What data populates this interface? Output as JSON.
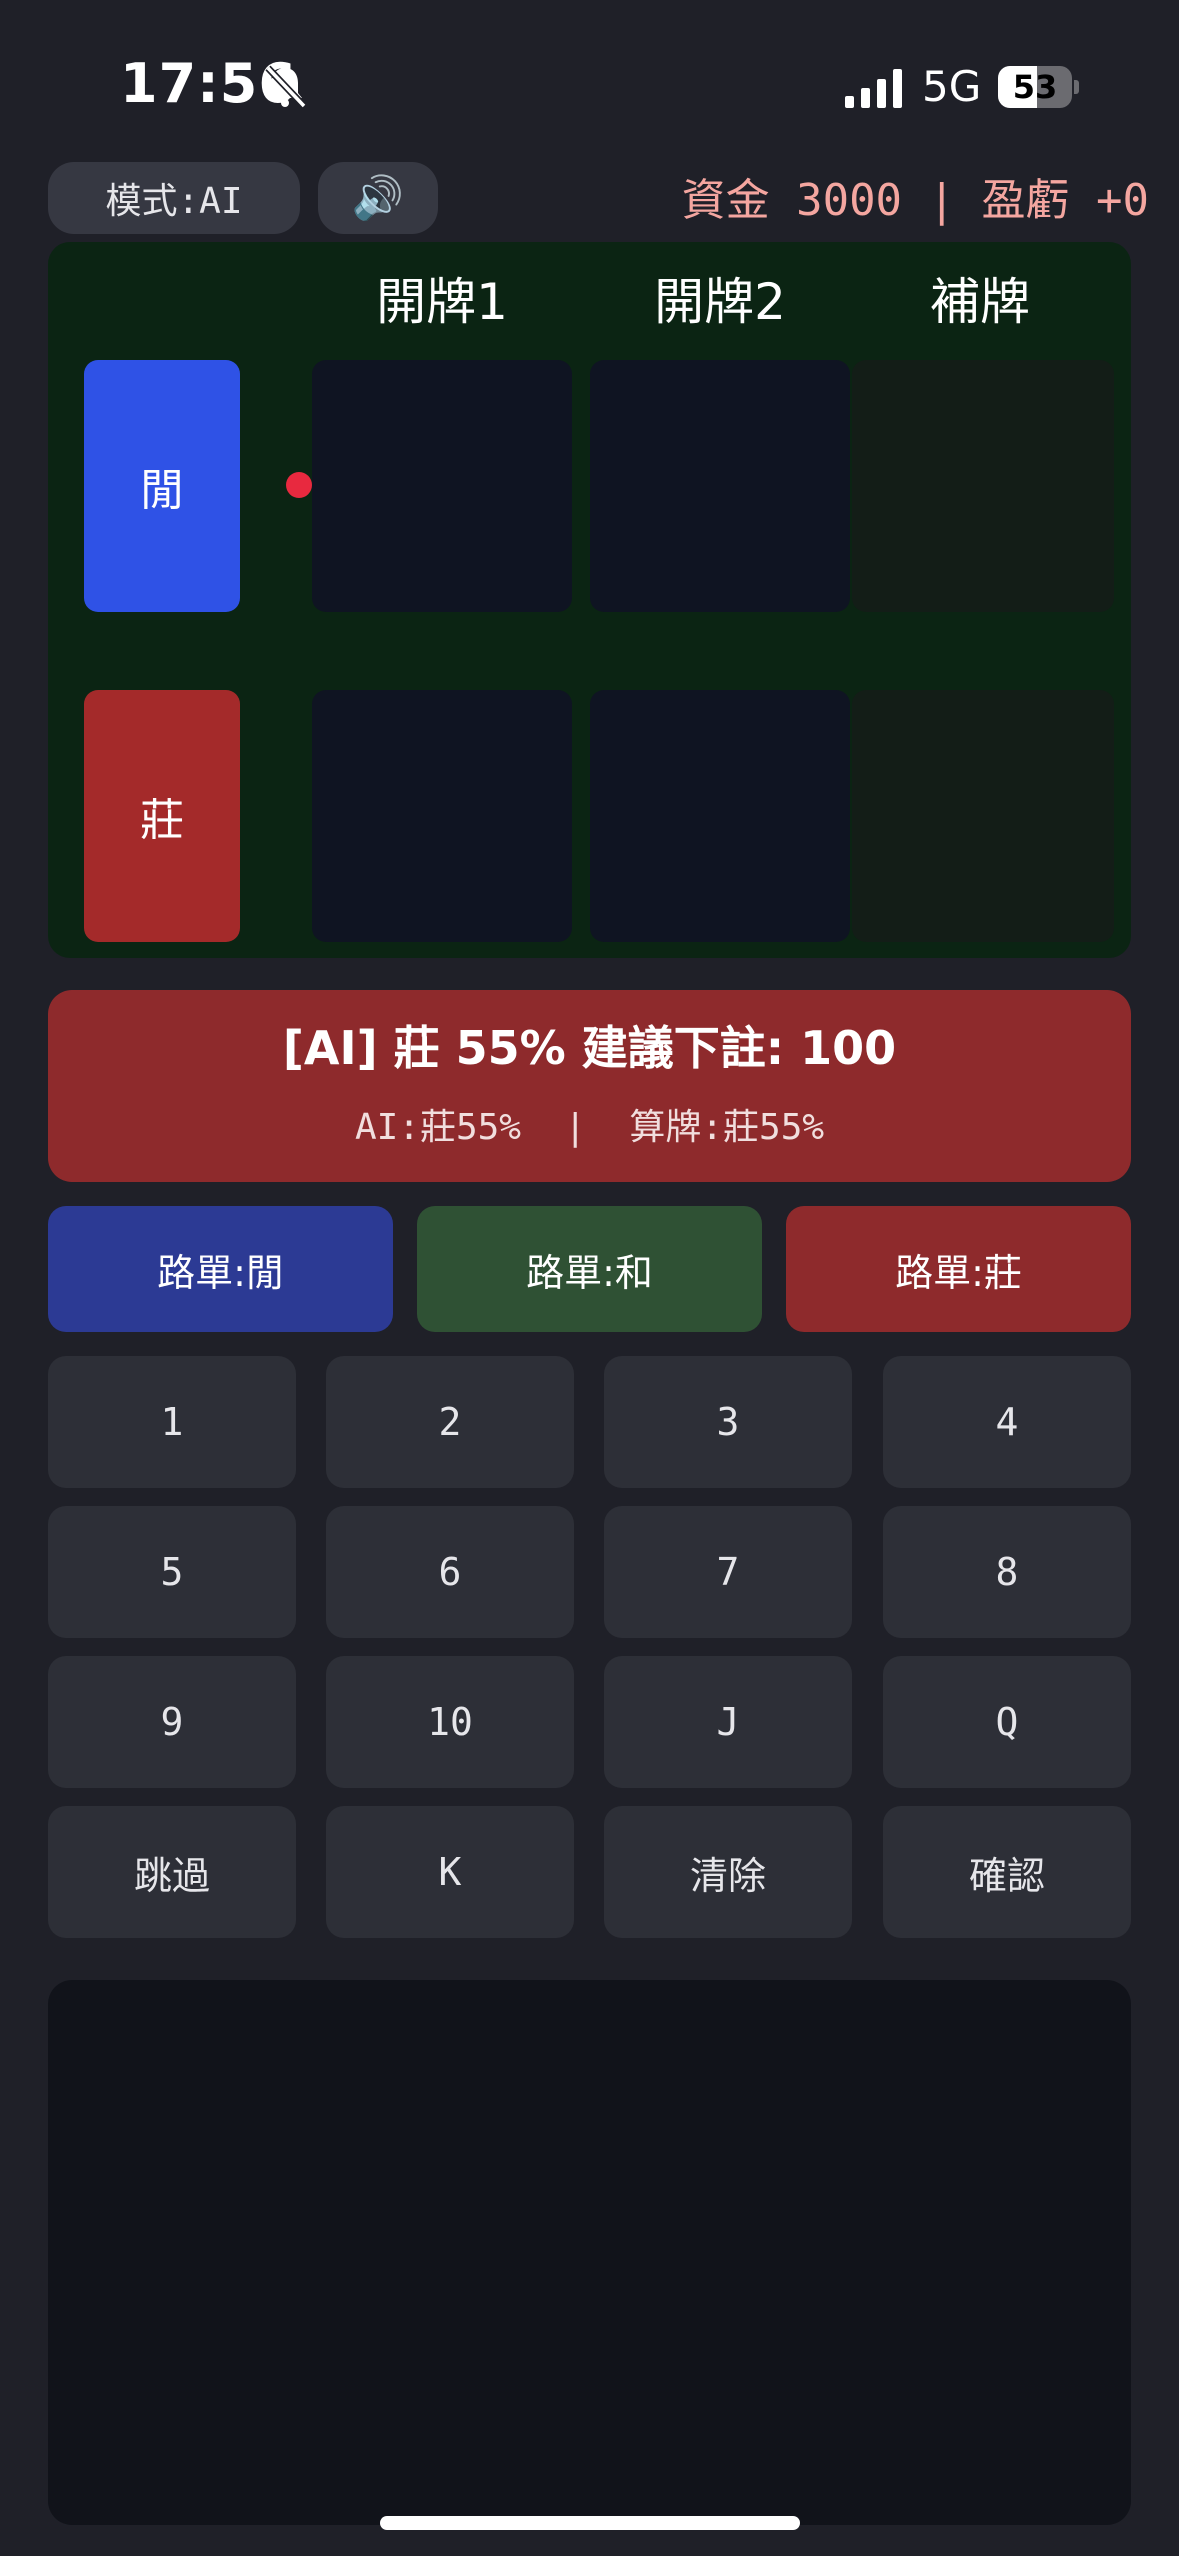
{
  "status_bar": {
    "time": "17:56",
    "network": "5G",
    "battery": "53",
    "battery_level": 0.53
  },
  "toolbar": {
    "mode_label": "模式:AI",
    "sound_icon": "speaker-icon",
    "funds_text": "資金 3000 | 盈虧 +0"
  },
  "table": {
    "columns": [
      "開牌1",
      "開牌2",
      "補牌"
    ],
    "player_label": "閒",
    "banker_label": "莊",
    "colors": {
      "player": "#2f52e6",
      "banker": "#a42a2a",
      "felt": "#0b2413",
      "indicator": "#e8293f"
    }
  },
  "advice": {
    "main": "[AI] 莊 55%  建議下註: 100",
    "sub": "AI:莊55%  |  算牌:莊55%",
    "color": "#8e2a2c"
  },
  "road_buttons": [
    {
      "label": "路單:閒",
      "color": "#2c3a94"
    },
    {
      "label": "路單:和",
      "color": "#2f5134"
    },
    {
      "label": "路單:莊",
      "color": "#8e2a2c"
    }
  ],
  "keypad": [
    [
      "1",
      "2",
      "3",
      "4"
    ],
    [
      "5",
      "6",
      "7",
      "8"
    ],
    [
      "9",
      "10",
      "J",
      "Q"
    ],
    [
      "跳過",
      "K",
      "清除",
      "確認"
    ]
  ]
}
